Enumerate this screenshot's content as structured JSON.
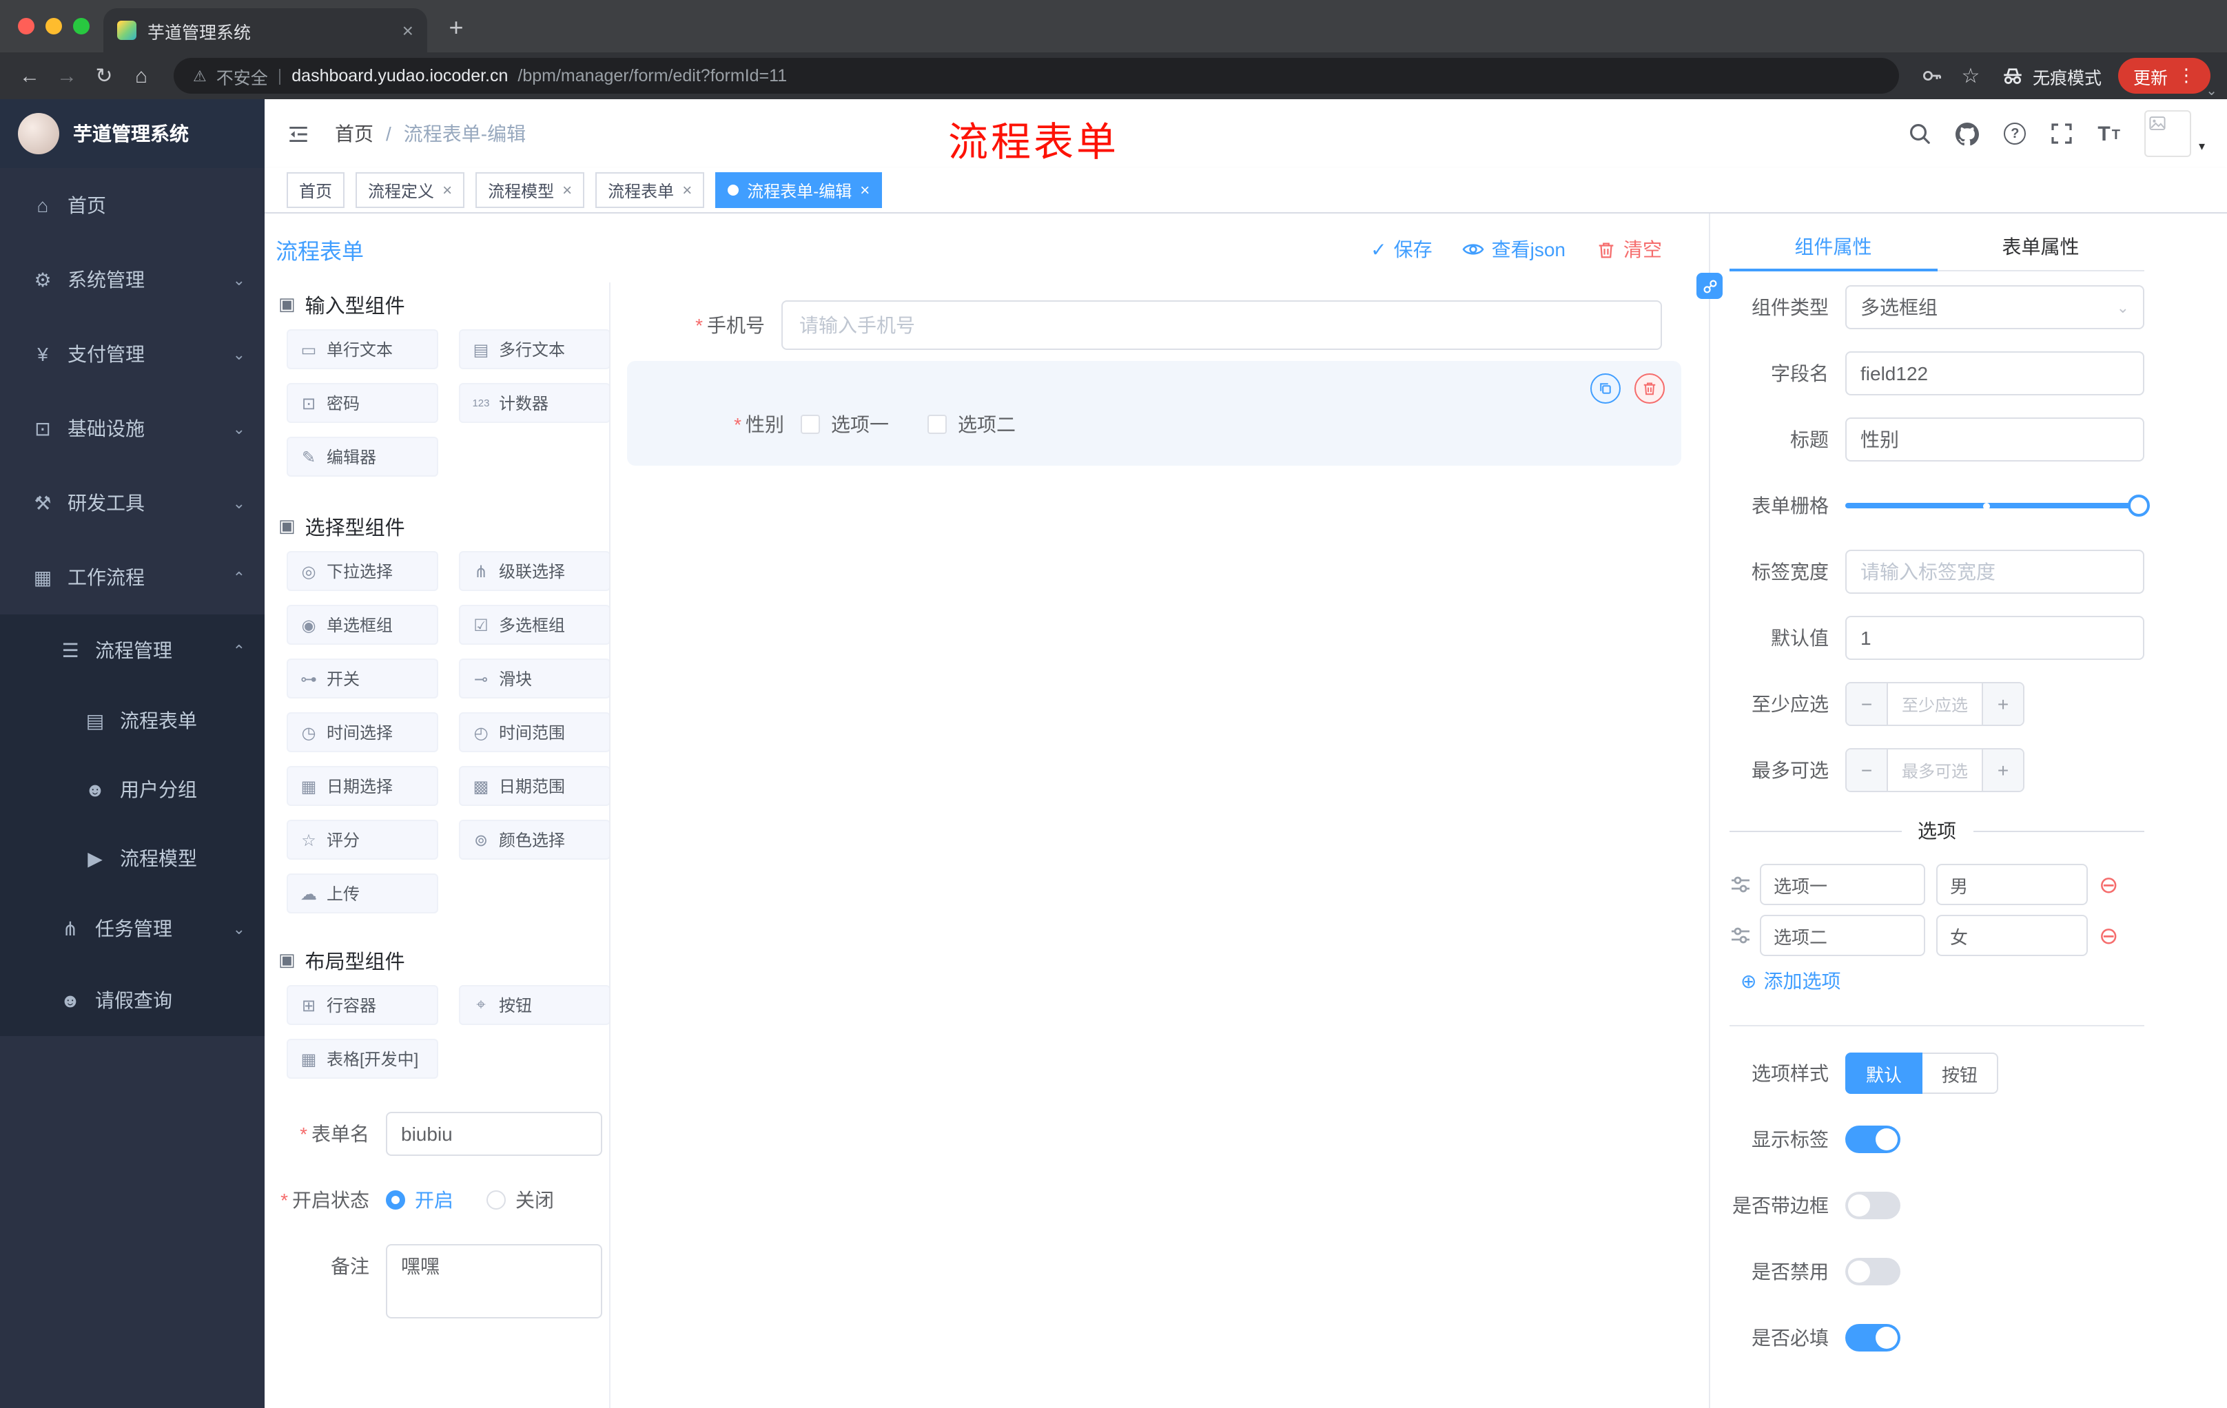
{
  "colors": {
    "primary": "#409eff",
    "danger": "#f56c6c",
    "annotation": "#ff0000",
    "sidebar_bg": "#2b3244",
    "chrome_bg": "#313337"
  },
  "icons": {
    "back": "←",
    "forward": "→",
    "reload": "↻",
    "home": "⌂",
    "warning": "⚠",
    "divider": "|",
    "star": "☆",
    "dots": "⋮",
    "chevron_down": "⌄",
    "chevron_up": "⌃",
    "new_tab": "+",
    "close": "×",
    "check": "✓",
    "plus_circle": "⊕",
    "minus_circle": "⊖",
    "asterisk": "*",
    "caret": "▾",
    "minus": "−",
    "plus": "+",
    "question": "?",
    "font_big": "T",
    "font_small": "T",
    "section": "▣",
    "menu_home": "⌂",
    "menu_system": "⚙",
    "menu_payment": "¥",
    "menu_infra": "⊡",
    "menu_devtools": "⚒",
    "menu_workflow": "▦",
    "menu_process_mgmt": "☰",
    "menu_process_form": "▤",
    "menu_user_group": "☻",
    "menu_process_model": "▶",
    "menu_task": "⋔",
    "menu_person": "☻"
  },
  "browser": {
    "tab_title": "芋道管理系统",
    "security": "不安全",
    "url_host": "dashboard.yudao.iocoder.cn",
    "url_path": "/bpm/manager/form/edit?formId=11",
    "incognito": "无痕模式",
    "update": "更新"
  },
  "sidebar": {
    "logo_title": "芋道管理系统",
    "home": "首页",
    "system": "系统管理",
    "payment": "支付管理",
    "infra": "基础设施",
    "devtools": "研发工具",
    "workflow": "工作流程",
    "process_mgmt": "流程管理",
    "process_form": "流程表单",
    "user_group": "用户分组",
    "process_model": "流程模型",
    "task_mgmt": "任务管理",
    "leave_query": "请假查询"
  },
  "navbar": {
    "breadcrumb_home": "首页",
    "breadcrumb_sep": "/",
    "breadcrumb_current": "流程表单-编辑",
    "annotation": "流程表单"
  },
  "tags": {
    "t0": "首页",
    "t1": "流程定义",
    "t2": "流程模型",
    "t3": "流程表单",
    "t4": "流程表单-编辑"
  },
  "designer": {
    "title": "流程表单",
    "save": "保存",
    "view_json": "查看json",
    "clear": "清空",
    "sec_input": {
      "title": "输入型组件",
      "items": [
        {
          "icon": "▭",
          "label": "单行文本"
        },
        {
          "icon": "▤",
          "label": "多行文本"
        },
        {
          "icon": "⊡",
          "label": "密码"
        },
        {
          "icon": "123",
          "label": "计数器"
        },
        {
          "icon": "✎",
          "label": "编辑器"
        }
      ]
    },
    "sec_select": {
      "title": "选择型组件",
      "items": [
        {
          "icon": "◎",
          "label": "下拉选择"
        },
        {
          "icon": "⋔",
          "label": "级联选择"
        },
        {
          "icon": "◉",
          "label": "单选框组"
        },
        {
          "icon": "☑",
          "label": "多选框组"
        },
        {
          "icon": "⊶",
          "label": "开关"
        },
        {
          "icon": "⊸",
          "label": "滑块"
        },
        {
          "icon": "◷",
          "label": "时间选择"
        },
        {
          "icon": "◴",
          "label": "时间范围"
        },
        {
          "icon": "▦",
          "label": "日期选择"
        },
        {
          "icon": "▩",
          "label": "日期范围"
        },
        {
          "icon": "☆",
          "label": "评分"
        },
        {
          "icon": "⊚",
          "label": "颜色选择"
        },
        {
          "icon": "☁",
          "label": "上传"
        }
      ]
    },
    "sec_layout": {
      "title": "布局型组件",
      "items": [
        {
          "icon": "⊞",
          "label": "行容器"
        },
        {
          "icon": "⌖",
          "label": "按钮"
        },
        {
          "icon": "▦",
          "label": "表格[开发中]"
        }
      ]
    },
    "meta": {
      "name_label": "表单名",
      "name_value": "biubiu",
      "status_label": "开启状态",
      "on_label": "开启",
      "off_label": "关闭",
      "remark_label": "备注",
      "remark_value": "嘿嘿"
    },
    "canvas": {
      "phone_label": "手机号",
      "phone_placeholder": "请输入手机号",
      "gender_label": "性别",
      "opt1": "选项一",
      "opt2": "选项二"
    }
  },
  "props": {
    "tab_component": "组件属性",
    "tab_form": "表单属性",
    "type_label": "组件类型",
    "type_value": "多选框组",
    "field_label": "字段名",
    "field_value": "field122",
    "title_label": "标题",
    "title_value": "性别",
    "grid_label": "表单栅格",
    "width_label": "标签宽度",
    "width_placeholder": "请输入标签宽度",
    "default_label": "默认值",
    "default_value": "1",
    "min_label": "至少应选",
    "min_placeholder": "至少应选",
    "max_label": "最多可选",
    "max_placeholder": "最多可选",
    "options_title": "选项",
    "opt0_label": "选项一",
    "opt0_value": "男",
    "opt1_label": "选项二",
    "opt1_value": "女",
    "add_option": "添加选项",
    "style_label": "选项样式",
    "style_default": "默认",
    "style_button": "按钮",
    "sw_show": "显示标签",
    "sw_border": "是否带边框",
    "sw_disabled": "是否禁用",
    "sw_required": "是否必填"
  }
}
